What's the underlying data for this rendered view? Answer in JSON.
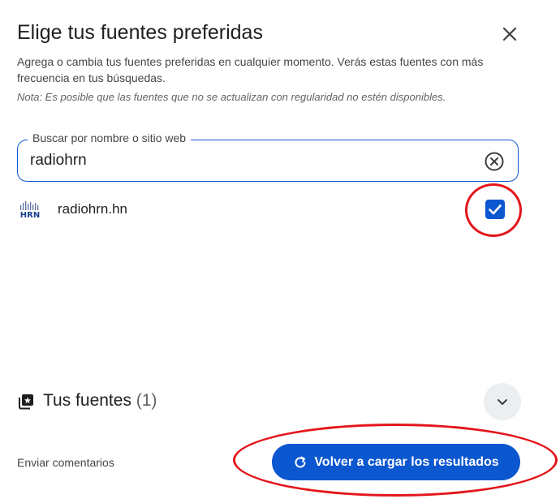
{
  "dialog": {
    "title": "Elige tus fuentes preferidas",
    "description": "Agrega o cambia tus fuentes preferidas en cualquier momento. Verás estas fuentes con más frecuencia en tus búsquedas.",
    "note": "Nota: Es posible que las fuentes que no se actualizan con regularidad no estén disponibles."
  },
  "search": {
    "label": "Buscar por nombre o sitio web",
    "value": "radiohrn"
  },
  "results": [
    {
      "logo_text": "HRN",
      "label": "radiohrn.hn",
      "checked": true
    }
  ],
  "sources": {
    "title": "Tus fuentes",
    "count": "(1)"
  },
  "footer": {
    "feedback": "Enviar comentarios",
    "reload": "Volver a cargar los resultados"
  },
  "colors": {
    "accent": "#0b57d0",
    "annotation": "#e3161c"
  },
  "icons": [
    "close-icon",
    "clear-icon",
    "check-icon",
    "sources-icon",
    "chevron-down-icon",
    "reload-icon"
  ]
}
